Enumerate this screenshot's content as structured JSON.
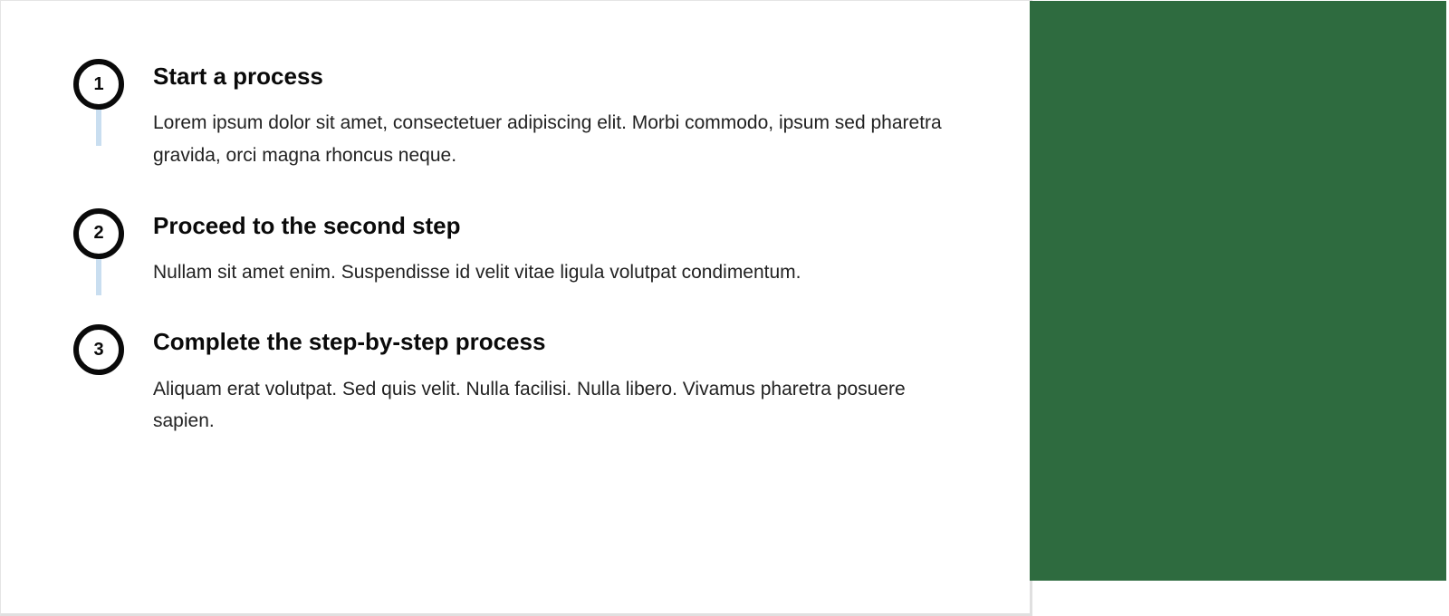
{
  "steps": [
    {
      "number": "1",
      "title": "Start a process",
      "description": "Lorem ipsum dolor sit amet, consectetuer adipiscing elit. Morbi commodo, ipsum sed pharetra gravida, orci magna rhoncus neque."
    },
    {
      "number": "2",
      "title": "Proceed to the second step",
      "description": "Nullam sit amet enim. Suspendisse id velit vitae ligula volutpat condimentum."
    },
    {
      "number": "3",
      "title": "Complete the step-by-step process",
      "description": "Aliquam erat volutpat. Sed quis velit. Nulla facilisi. Nulla libero. Vivamus pharetra posuere sapien."
    }
  ],
  "colors": {
    "circle_border": "#0a0a0a",
    "connector": "#c9def0",
    "right_block": "#2e6b3f"
  }
}
